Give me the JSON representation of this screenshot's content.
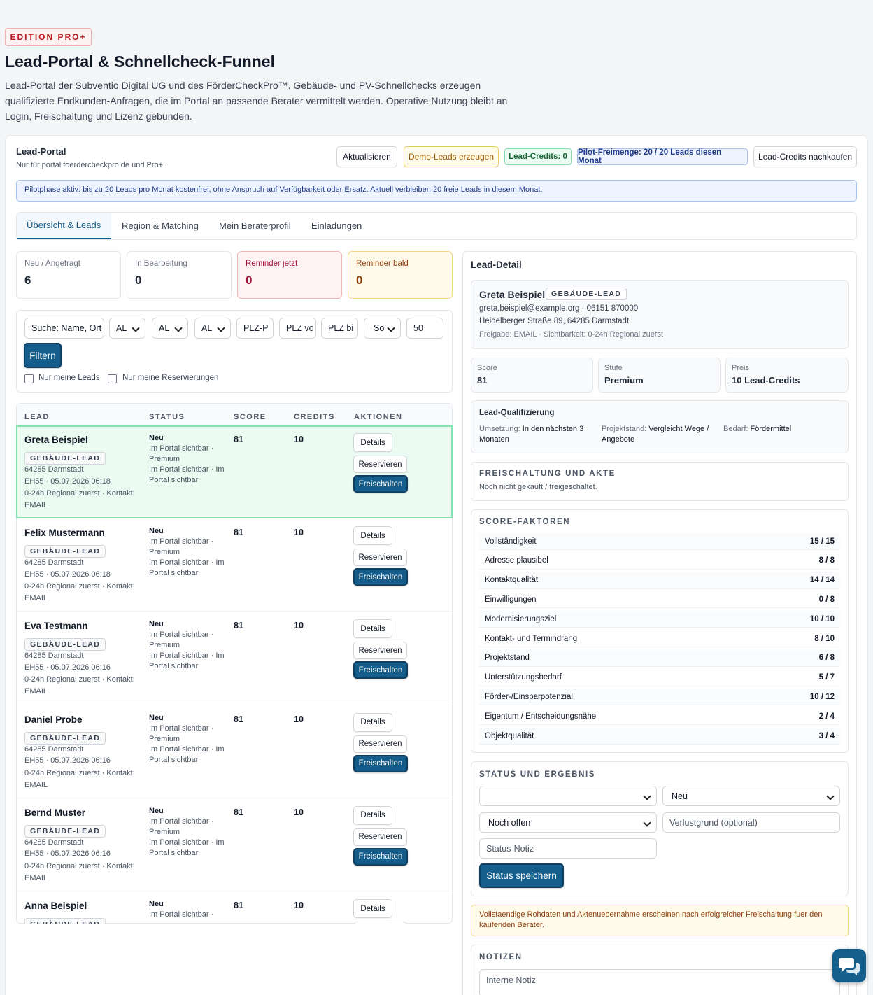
{
  "header": {
    "edition": "EDITION PRO+",
    "title": "Lead-Portal & Schnellcheck-Funnel",
    "intro": "Lead-Portal der Subventio Digital UG und des FörderCheckPro™. Gebäude- und PV-Schnellchecks erzeugen qualifizierte Endkunden-Anfragen, die im Portal an passende Berater vermittelt werden. Operative Nutzung bleibt an Login, Freischaltung und Lizenz gebunden."
  },
  "portal": {
    "title": "Lead-Portal",
    "subtitle": "Nur für portal.foerdercheckpro.de und Pro+.",
    "refresh_label": "Aktualisieren",
    "demo_label": "Demo-Leads erzeugen",
    "credits_label": "Lead-Credits: 0",
    "pilot_label": "Pilot-Freimenge: 20 / 20 Leads diesen Monat",
    "buy_label": "Lead-Credits nachkaufen",
    "pilot_notice": "Pilotphase aktiv: bis zu 20 Leads pro Monat kostenfrei, ohne Anspruch auf Verfügbarkeit oder Ersatz. Aktuell verbleiben 20 freie Leads in diesem Monat."
  },
  "tabs": [
    "Übersicht & Leads",
    "Region & Matching",
    "Mein Beraterprofil",
    "Einladungen"
  ],
  "stats": [
    {
      "label": "Neu / Angefragt",
      "value": "6"
    },
    {
      "label": "In Bearbeitung",
      "value": "0"
    },
    {
      "label": "Reminder jetzt",
      "value": "0"
    },
    {
      "label": "Reminder bald",
      "value": "0"
    }
  ],
  "filters": {
    "search": "Suche: Name, Ort",
    "sel1": "AL",
    "sel2": "AL",
    "sel3": "AL",
    "plz_prefix": "PLZ-P",
    "plz_from": "PLZ vo",
    "plz_to": "PLZ bi",
    "sort": "So",
    "limit": "50",
    "filter_label": "Filtern",
    "only_mine": "Nur meine Leads",
    "only_reservations": "Nur meine Reservierungen"
  },
  "table": {
    "headers": [
      "LEAD",
      "STATUS",
      "SCORE",
      "CREDITS",
      "AKTIONEN"
    ],
    "details_label": "Details",
    "reserve_label": "Reservieren",
    "unlock_label": "Freischalten",
    "rows": [
      {
        "name": "Greta Beispiel",
        "tag": "GEBÄUDE-LEAD",
        "city": "64285 Darmstadt",
        "meta1": "EH55 · 05.07.2026 06:18",
        "meta2": "0-24h Regional zuerst · Kontakt:",
        "meta3": "EMAIL",
        "status": "Neu",
        "st1": "Im Portal sichtbar ·",
        "st2": "Premium",
        "st3": "Im Portal sichtbar · Im",
        "st4": "Portal sichtbar",
        "score": "81",
        "credits": "10"
      },
      {
        "name": "Felix Mustermann",
        "tag": "GEBÄUDE-LEAD",
        "city": "64285 Darmstadt",
        "meta1": "EH55 · 05.07.2026 06:18",
        "meta2": "0-24h Regional zuerst · Kontakt:",
        "meta3": "EMAIL",
        "status": "Neu",
        "st1": "Im Portal sichtbar ·",
        "st2": "Premium",
        "st3": "Im Portal sichtbar · Im",
        "st4": "Portal sichtbar",
        "score": "81",
        "credits": "10"
      },
      {
        "name": "Eva Testmann",
        "tag": "GEBÄUDE-LEAD",
        "city": "64285 Darmstadt",
        "meta1": "EH55 · 05.07.2026 06:16",
        "meta2": "0-24h Regional zuerst · Kontakt:",
        "meta3": "EMAIL",
        "status": "Neu",
        "st1": "Im Portal sichtbar ·",
        "st2": "Premium",
        "st3": "Im Portal sichtbar · Im",
        "st4": "Portal sichtbar",
        "score": "81",
        "credits": "10"
      },
      {
        "name": "Daniel Probe",
        "tag": "GEBÄUDE-LEAD",
        "city": "64285 Darmstadt",
        "meta1": "EH55 · 05.07.2026 06:16",
        "meta2": "0-24h Regional zuerst · Kontakt:",
        "meta3": "EMAIL",
        "status": "Neu",
        "st1": "Im Portal sichtbar ·",
        "st2": "Premium",
        "st3": "Im Portal sichtbar · Im",
        "st4": "Portal sichtbar",
        "score": "81",
        "credits": "10"
      },
      {
        "name": "Bernd Muster",
        "tag": "GEBÄUDE-LEAD",
        "city": "64285 Darmstadt",
        "meta1": "EH55 · 05.07.2026 06:16",
        "meta2": "0-24h Regional zuerst · Kontakt:",
        "meta3": "EMAIL",
        "status": "Neu",
        "st1": "Im Portal sichtbar ·",
        "st2": "Premium",
        "st3": "Im Portal sichtbar · Im",
        "st4": "Portal sichtbar",
        "score": "81",
        "credits": "10"
      },
      {
        "name": "Anna Beispiel",
        "tag": "GEBÄUDE-LEAD",
        "city": "",
        "meta1": "",
        "meta2": "",
        "meta3": "",
        "status": "Neu",
        "st1": "Im Portal sichtbar ·",
        "st2": "",
        "st3": "",
        "st4": "",
        "score": "81",
        "credits": "10"
      }
    ]
  },
  "detail": {
    "title": "Lead-Detail",
    "name": "Greta Beispiel",
    "tag": "GEBÄUDE-LEAD",
    "contact": "greta.beispiel@example.org · 06151 870000",
    "address": "Heidelberger Straße 89, 64285 Darmstadt",
    "release": "Freigabe: EMAIL · Sichtbarkeit: 0-24h Regional zuerst",
    "score_label": "Score",
    "score_value": "81",
    "level_label": "Stufe",
    "level_value": "Premium",
    "price_label": "Preis",
    "price_value": "10 Lead-Credits",
    "qual_title": "Lead-Qualifizierung",
    "qual1_label": "Umsetzung:",
    "qual1_value": "In den nächsten 3",
    "qual1_value2": "Monaten",
    "qual2_label": "Projektstand:",
    "qual2_value": "Vergleicht Wege /",
    "qual2_value2": "Angebote",
    "qual3_label": "Bedarf:",
    "qual3_value": "Fördermittel",
    "unlock_title": "FREISCHALTUNG UND AKTE",
    "unlock_text": "Noch nicht gekauft / freigeschaltet.",
    "factors_title": "SCORE-FAKTOREN",
    "factors": [
      {
        "label": "Vollständigkeit",
        "value": "15 / 15"
      },
      {
        "label": "Adresse plausibel",
        "value": "8 / 8"
      },
      {
        "label": "Kontaktqualität",
        "value": "14 / 14"
      },
      {
        "label": "Einwilligungen",
        "value": "0 / 8"
      },
      {
        "label": "Modernisierungsziel",
        "value": "10 / 10"
      },
      {
        "label": "Kontakt- und Termindrang",
        "value": "8 / 10"
      },
      {
        "label": "Projektstand",
        "value": "6 / 8"
      },
      {
        "label": "Unterstützungsbedarf",
        "value": "5 / 7"
      },
      {
        "label": "Förder-/Einsparpotenzial",
        "value": "10 / 12"
      },
      {
        "label": "Eigentum / Entscheidungsnähe",
        "value": "2 / 4"
      },
      {
        "label": "Objektqualität",
        "value": "3 / 4"
      }
    ],
    "status_title": "STATUS UND ERGEBNIS",
    "status_select1": "",
    "status_select2": "Neu",
    "outcome_select": "Noch offen",
    "loss_placeholder": "Verlustgrund (optional)",
    "note_placeholder": "Status-Notiz",
    "save_label": "Status speichern",
    "warning": "Vollstaendige Rohdaten und Aktenuebernahme erscheinen nach erfolgreicher Freischaltung fuer den kaufenden Berater.",
    "notes_title": "NOTIZEN",
    "internal_note": "Interne Notiz"
  }
}
